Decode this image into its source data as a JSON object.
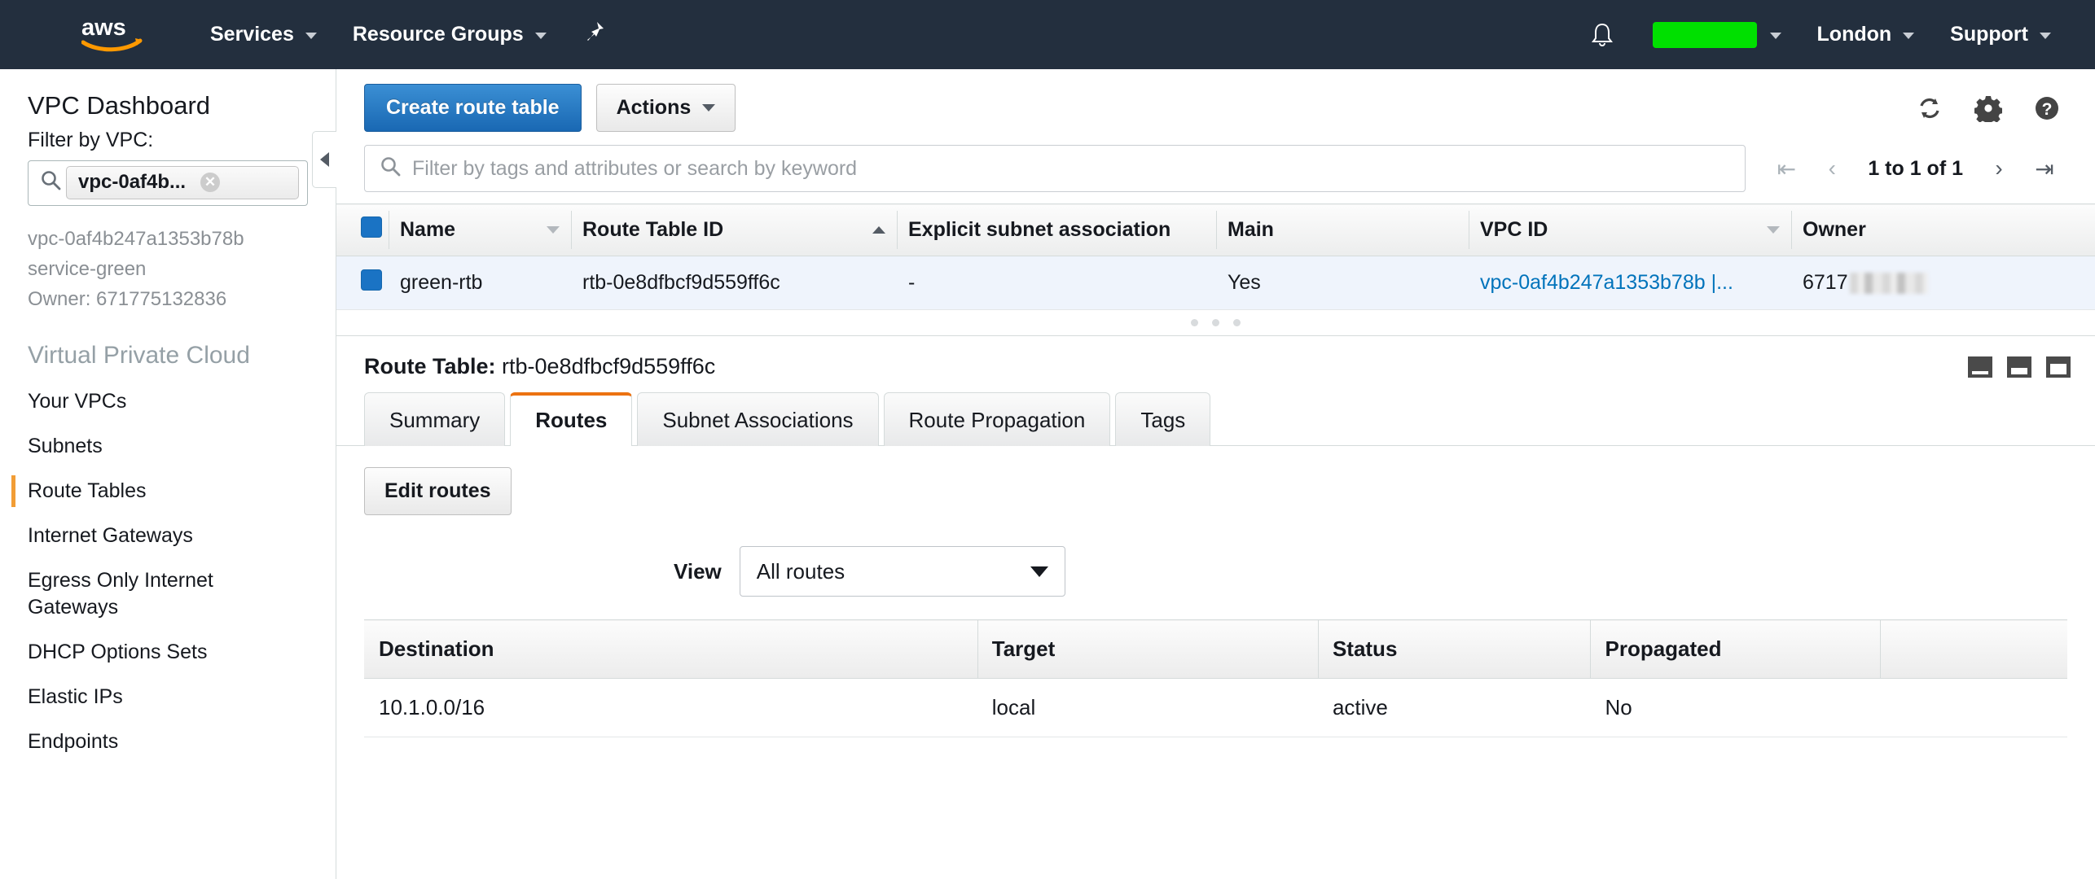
{
  "topnav": {
    "logo_alt": "aws",
    "services": "Services",
    "resource_groups": "Resource Groups",
    "pin_icon": "pin-icon",
    "bell_icon": "bell-icon",
    "account_redacted_color": "#00e000",
    "region": "London",
    "support": "Support"
  },
  "sidebar": {
    "title": "VPC Dashboard",
    "filter_label": "Filter by VPC:",
    "filter_token": "vpc-0af4b...",
    "meta_lines": [
      "vpc-0af4b247a1353b78b",
      "service-green",
      "Owner: 671775132836"
    ],
    "section_title": "Virtual Private Cloud",
    "items": [
      {
        "label": "Your VPCs",
        "active": false
      },
      {
        "label": "Subnets",
        "active": false
      },
      {
        "label": "Route Tables",
        "active": true
      },
      {
        "label": "Internet Gateways",
        "active": false
      },
      {
        "label": "Egress Only Internet Gateways",
        "active": false
      },
      {
        "label": "DHCP Options Sets",
        "active": false
      },
      {
        "label": "Elastic IPs",
        "active": false
      },
      {
        "label": "Endpoints",
        "active": false
      }
    ]
  },
  "toolbar": {
    "create_label": "Create route table",
    "actions_label": "Actions",
    "refresh_icon": "refresh-icon",
    "settings_icon": "gear-icon",
    "help_icon": "help-icon"
  },
  "filterbar": {
    "placeholder": "Filter by tags and attributes or search by keyword",
    "pagination_label": "1 to 1 of 1",
    "first_icon": "first-page-icon",
    "prev_icon": "previous-page-icon",
    "next_icon": "next-page-icon",
    "last_icon": "last-page-icon"
  },
  "table": {
    "columns": [
      "Name",
      "Route Table ID",
      "Explicit subnet association",
      "Main",
      "VPC ID",
      "Owner"
    ],
    "sort_column": "Route Table ID",
    "sort_direction": "asc",
    "rows": [
      {
        "selected": true,
        "name": "green-rtb",
        "route_table_id": "rtb-0e8dfbcf9d559ff6c",
        "explicit_subnet_association": "-",
        "main": "Yes",
        "vpc_id": "vpc-0af4b247a1353b78b |...",
        "owner_prefix": "6717"
      }
    ]
  },
  "detail": {
    "label": "Route Table:",
    "value": "rtb-0e8dfbcf9d559ff6c",
    "panel_icons": [
      "panel-small-icon",
      "panel-medium-icon",
      "panel-large-icon"
    ],
    "tabs": [
      {
        "label": "Summary",
        "active": false
      },
      {
        "label": "Routes",
        "active": true
      },
      {
        "label": "Subnet Associations",
        "active": false
      },
      {
        "label": "Route Propagation",
        "active": false
      },
      {
        "label": "Tags",
        "active": false
      }
    ],
    "edit_routes_label": "Edit routes",
    "view_label": "View",
    "view_value": "All routes",
    "routes_columns": [
      "Destination",
      "Target",
      "Status",
      "Propagated"
    ],
    "routes_rows": [
      {
        "destination": "10.1.0.0/16",
        "target": "local",
        "status": "active",
        "propagated": "No"
      }
    ]
  }
}
